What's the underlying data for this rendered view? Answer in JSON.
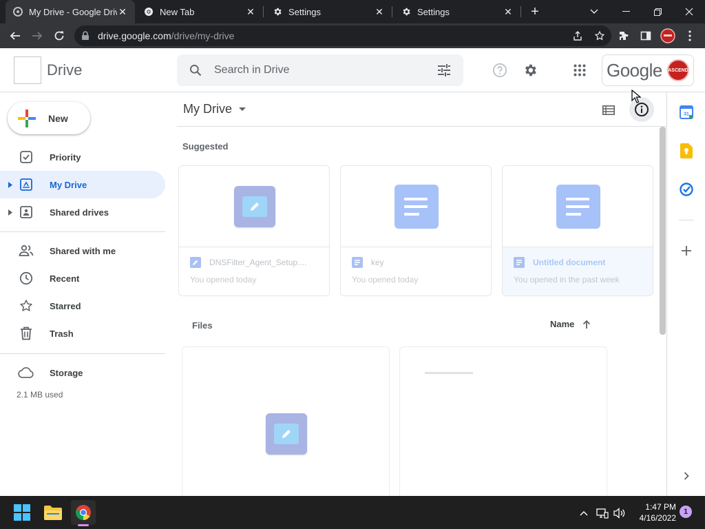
{
  "browser": {
    "tabs": [
      {
        "title": "My Drive - Google Drive",
        "icon": "drive-favicon",
        "active": true
      },
      {
        "title": "New Tab",
        "icon": "chrome-favicon",
        "active": false
      },
      {
        "title": "Settings",
        "icon": "gear-favicon",
        "active": false
      },
      {
        "title": "Settings",
        "icon": "gear-favicon",
        "active": false
      }
    ],
    "url_host": "drive.google.com",
    "url_path": "/drive/my-drive"
  },
  "header": {
    "brand": "Drive",
    "search_placeholder": "Search in Drive",
    "account_brand": "Google",
    "avatar_text": "ASCEND"
  },
  "sidebar": {
    "new_label": "New",
    "items": [
      {
        "label": "Priority",
        "icon": "priority-check-icon"
      },
      {
        "label": "My Drive",
        "icon": "my-drive-icon"
      },
      {
        "label": "Shared drives",
        "icon": "shared-drives-icon"
      },
      {
        "label": "Shared with me",
        "icon": "people-icon"
      },
      {
        "label": "Recent",
        "icon": "clock-icon"
      },
      {
        "label": "Starred",
        "icon": "star-icon"
      },
      {
        "label": "Trash",
        "icon": "trash-icon"
      },
      {
        "label": "Storage",
        "icon": "cloud-icon"
      }
    ],
    "storage_used": "2.1 MB used"
  },
  "main": {
    "breadcrumb": "My Drive",
    "suggested_title": "Suggested",
    "files_title": "Files",
    "sort_label": "Name",
    "suggested": [
      {
        "name": "DNSFilter_Agent_Setup....",
        "subtitle": "You opened today",
        "type": "drawing"
      },
      {
        "name": "key",
        "subtitle": "You opened today",
        "type": "doc"
      },
      {
        "name": "Untitled document",
        "subtitle": "You opened in the past week",
        "type": "doc"
      }
    ]
  },
  "taskbar": {
    "time": "1:47 PM",
    "date": "4/16/2022",
    "notification_count": "1"
  },
  "colors": {
    "accent": "#1967d2",
    "active_nav_bg": "#e8f0fe",
    "chrome_dark": "#202124"
  }
}
